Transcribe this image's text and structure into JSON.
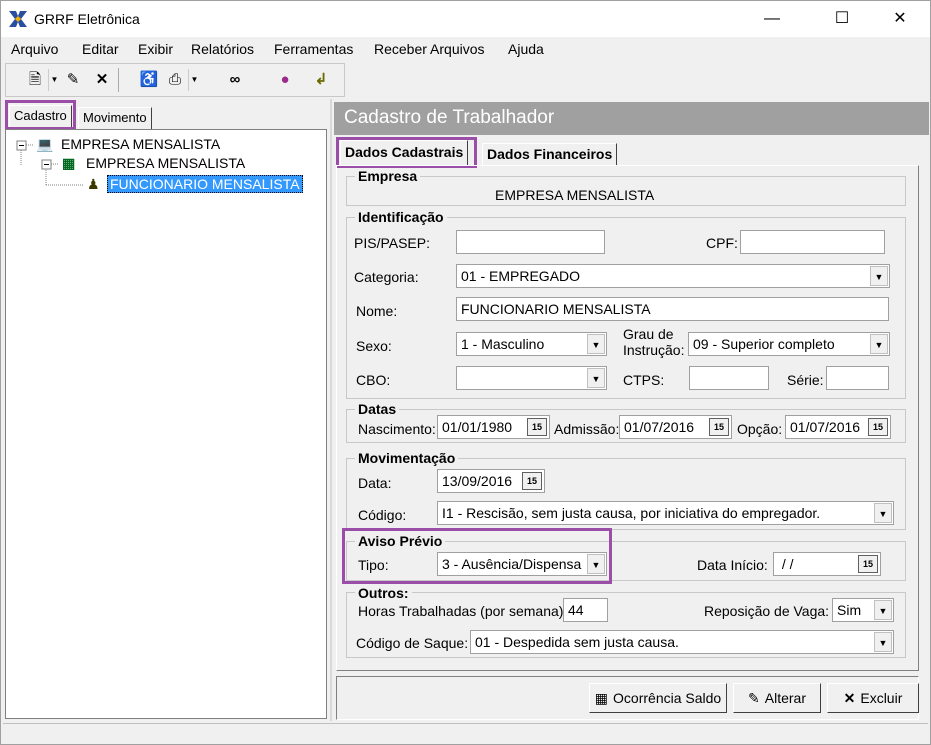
{
  "window": {
    "title": "GRRF Eletrônica"
  },
  "menu": [
    "Arquivo",
    "Editar",
    "Exibir",
    "Relatórios",
    "Ferramentas",
    "Receber Arquivos",
    "Ajuda"
  ],
  "left_tabs": {
    "cadastro": "Cadastro",
    "movimento": "Movimento"
  },
  "tree": {
    "root": "EMPRESA MENSALISTA",
    "child": "EMPRESA MENSALISTA",
    "leaf": "FUNCIONARIO MENSALISTA"
  },
  "header": {
    "title": "Cadastro de Trabalhador"
  },
  "form_tabs": {
    "dados_cadastrais": "Dados Cadastrais",
    "dados_financeiros": "Dados Financeiros"
  },
  "empresa": {
    "title": "Empresa",
    "name": "EMPRESA MENSALISTA"
  },
  "identificacao": {
    "title": "Identificação",
    "pis_label": "PIS/PASEP:",
    "pis_value": "",
    "cpf_label": "CPF:",
    "cpf_value": "",
    "categoria_label": "Categoria:",
    "categoria_value": "01 - EMPREGADO",
    "nome_label": "Nome:",
    "nome_value": "FUNCIONARIO MENSALISTA",
    "sexo_label": "Sexo:",
    "sexo_value": "1 - Masculino",
    "grau_label_1": "Grau de",
    "grau_label_2": "Instrução:",
    "grau_value": "09 - Superior completo",
    "cbo_label": "CBO:",
    "cbo_value": "",
    "ctps_label": "CTPS:",
    "ctps_value": "",
    "serie_label": "Série:",
    "serie_value": ""
  },
  "datas": {
    "title": "Datas",
    "nascimento_label": "Nascimento:",
    "nascimento_value": "01/01/1980",
    "admissao_label": "Admissão:",
    "admissao_value": "01/07/2016",
    "opcao_label": "Opção:",
    "opcao_value": "01/07/2016"
  },
  "movimentacao": {
    "title": "Movimentação",
    "data_label": "Data:",
    "data_value": "13/09/2016",
    "codigo_label": "Código:",
    "codigo_value": "I1 - Rescisão, sem justa causa, por iniciativa do empregador."
  },
  "aviso_previo": {
    "title": "Aviso Prévio",
    "tipo_label": "Tipo:",
    "tipo_value": "3 - Ausência/Dispensa",
    "data_inicio_label": "Data Início:",
    "data_inicio_value": " / /"
  },
  "outros": {
    "title": "Outros:",
    "horas_label": "Horas Trabalhadas (por semana):",
    "horas_value": "44",
    "reposicao_label": "Reposição de Vaga:",
    "reposicao_value": "Sim",
    "saque_label": "Código de Saque:",
    "saque_value": "01 - Despedida sem justa causa."
  },
  "buttons": {
    "ocorrencia": "Ocorrência Saldo",
    "alterar": "Alterar",
    "excluir": "Excluir"
  },
  "date_btn_glyph": "15",
  "colors": {
    "highlight": "#9b4ea8",
    "header_bg": "#a0a0a0",
    "selection": "#3399ff"
  }
}
